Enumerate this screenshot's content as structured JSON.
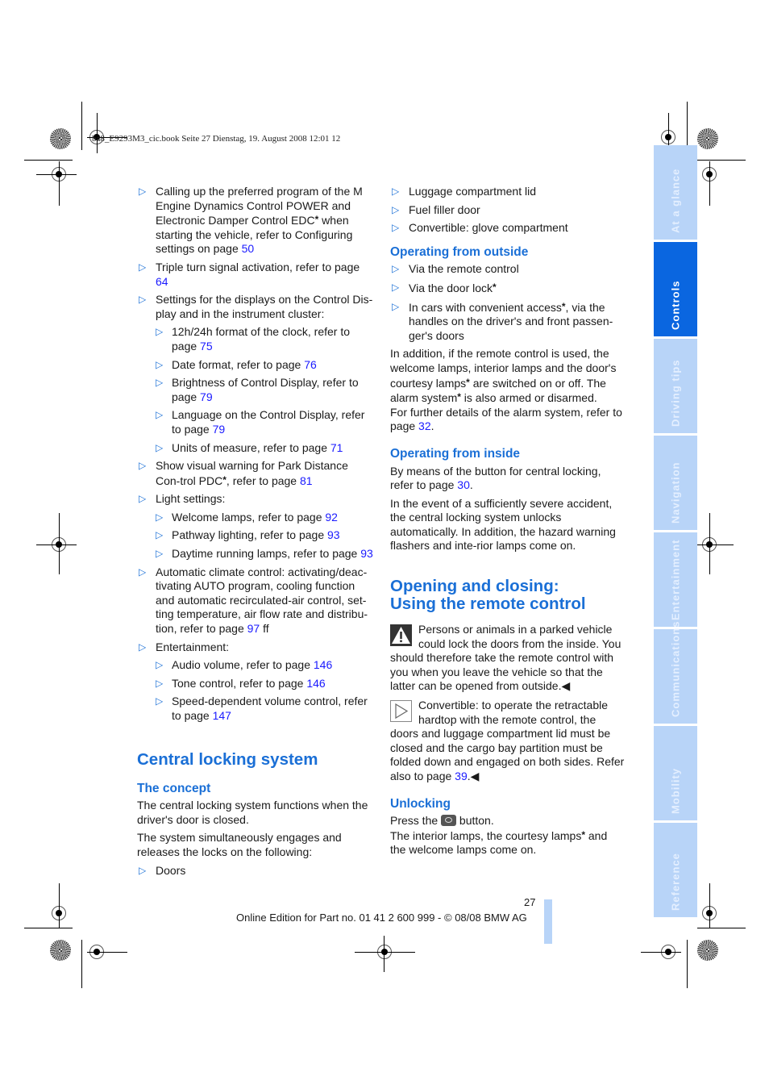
{
  "header": {
    "meta": "ba8_E9293M3_cic.book  Seite 27  Dienstag, 19. August 2008  12:01 12"
  },
  "left_column": {
    "items": [
      {
        "level": 1,
        "text": "Calling up the preferred program of the M Engine Dynamics Control POWER and Electronic Damper Control EDC",
        "star": true,
        "text2": " when starting the vehicle, refer to Configuring settings on page ",
        "page": "50"
      },
      {
        "level": 1,
        "text": "Triple turn signal activation, refer to page ",
        "page": "64"
      },
      {
        "level": 1,
        "text": "Settings for the displays on the Control Dis-play and in the instrument cluster:"
      },
      {
        "level": 2,
        "text": "12h/24h format of the clock, refer to page ",
        "page": "75"
      },
      {
        "level": 2,
        "text": "Date format, refer to page ",
        "page": "76"
      },
      {
        "level": 2,
        "text": "Brightness of Control Display, refer to page ",
        "page": "79"
      },
      {
        "level": 2,
        "text": "Language on the Control Display, refer to page ",
        "page": "79"
      },
      {
        "level": 2,
        "text": "Units of measure, refer to page ",
        "page": "71"
      },
      {
        "level": 1,
        "text": "Show visual warning for Park Distance Con-trol PDC",
        "star": true,
        "text2": ", refer to page ",
        "page": "81"
      },
      {
        "level": 1,
        "text": "Light settings:"
      },
      {
        "level": 2,
        "text": "Welcome lamps, refer to page ",
        "page": "92"
      },
      {
        "level": 2,
        "text": "Pathway lighting, refer to page ",
        "page": "93"
      },
      {
        "level": 2,
        "text": "Daytime running lamps, refer to page ",
        "page": "93"
      },
      {
        "level": 1,
        "text": "Automatic climate control: activating/deac-tivating AUTO program, cooling function and automatic recirculated-air control, set-ting temperature, air flow rate and distribu-tion, refer to page ",
        "page": "97",
        "suffix": " ff"
      },
      {
        "level": 1,
        "text": "Entertainment:"
      },
      {
        "level": 2,
        "text": "Audio volume, refer to page ",
        "page": "146"
      },
      {
        "level": 2,
        "text": "Tone control, refer to page ",
        "page": "146"
      },
      {
        "level": 2,
        "text": "Speed-dependent volume control, refer to page ",
        "page": "147"
      }
    ],
    "section_title": "Central locking system",
    "concept_title": "The concept",
    "concept_p1": "The central locking system functions when the driver's door is closed.",
    "concept_p2": "The system simultaneously engages and releases the locks on the following:",
    "concept_item": "Doors"
  },
  "right_column": {
    "items_top": [
      "Luggage compartment lid",
      "Fuel filler door",
      "Convertible: glove compartment"
    ],
    "outside_title": "Operating from outside",
    "outside_items": [
      {
        "text": "Via the remote control"
      },
      {
        "text": "Via the door lock",
        "star": true
      },
      {
        "text": "In cars with convenient access",
        "star": true,
        "text2": ", via the handles on the driver's and front passen-ger's doors"
      }
    ],
    "outside_p1a": "In addition, if the remote control is used, the welcome lamps, interior lamps and the door's courtesy lamps",
    "outside_p1b": " are switched on or off. The alarm system",
    "outside_p1c": " is also armed or disarmed.",
    "outside_p2": "For further details of the alarm system, refer to page ",
    "outside_p2_page": "32",
    "inside_title": "Operating from inside",
    "inside_p1": "By means of the button for central locking, refer to page ",
    "inside_p1_page": "30",
    "inside_p2": "In the event of a sufficiently severe accident, the central locking system unlocks automatically. In addition, the hazard warning flashers and inte-rior lamps come on.",
    "remote_title_1": "Opening and closing:",
    "remote_title_2": "Using the remote control",
    "warning_text": "Persons or animals in a parked vehicle could lock the doors from the inside. You should therefore take the remote control with you when you leave the vehicle so that the latter can be opened from outside.",
    "tip_text": "Convertible: to operate the retractable hardtop with the remote control, the doors and luggage compartment lid must be closed and the cargo bay partition must be folded down and engaged on both sides. Refer also to page ",
    "tip_page": "39",
    "end_mark": "◀",
    "unlocking_title": "Unlocking",
    "unlock_p1a": "Press the ",
    "unlock_p1b": " button.",
    "unlock_p2a": "The interior lamps, the courtesy lamps",
    "unlock_p2b": " and the welcome lamps come on."
  },
  "sidebar": {
    "tabs": [
      {
        "label": "At a glance",
        "active": false
      },
      {
        "label": "Controls",
        "active": true
      },
      {
        "label": "Driving tips",
        "active": false
      },
      {
        "label": "Navigation",
        "active": false
      },
      {
        "label": "Entertainment",
        "active": false
      },
      {
        "label": "Communications",
        "active": false
      },
      {
        "label": "Mobility",
        "active": false
      },
      {
        "label": "Reference",
        "active": false
      }
    ]
  },
  "footer": {
    "page_number": "27",
    "edition": "Online Edition for Part no. 01 41 2 600 999 - © 08/08 BMW AG"
  },
  "glyphs": {
    "bullet": "▷",
    "star": "*"
  }
}
